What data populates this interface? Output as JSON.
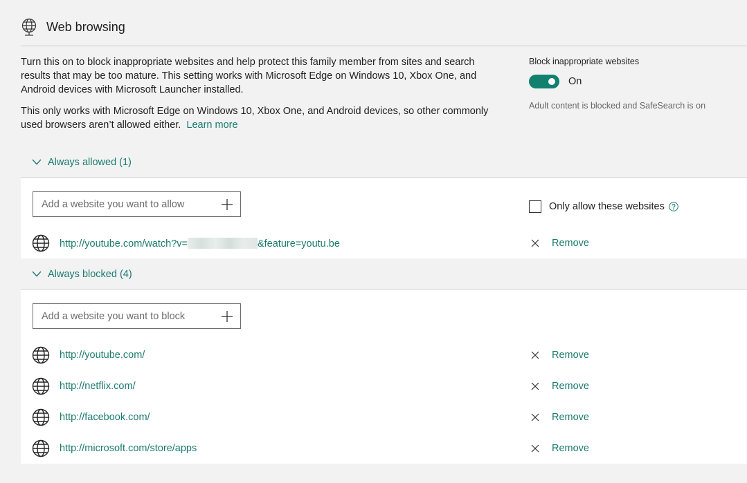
{
  "header": {
    "title": "Web browsing",
    "icon": "web-filter-icon"
  },
  "description": {
    "paragraph1": "Turn this on to block inappropriate websites and help protect this family member from sites and search results that may be too mature. This setting works with Microsoft Edge on Windows 10, Xbox One, and Android devices with Microsoft Launcher installed.",
    "paragraph2": "This only works with Microsoft Edge on Windows 10, Xbox One, and Android devices, so other commonly used browsers aren’t allowed either.",
    "learn_more": "Learn more"
  },
  "toggle": {
    "title": "Block inappropriate websites",
    "state": "On",
    "enabled": true,
    "subtitle": "Adult content is blocked and SafeSearch is on"
  },
  "allowed": {
    "header": "Always allowed (1)",
    "placeholder": "Add a website you want to allow",
    "only_allow_label": "Only allow these websites",
    "only_allow_checked": false,
    "items": [
      {
        "url_prefix": "http://youtube.com/watch?v=",
        "url_suffix": "&feature=youtu.be",
        "remove": "Remove"
      }
    ]
  },
  "blocked": {
    "header": "Always blocked (4)",
    "placeholder": "Add a website you want to block",
    "items": [
      {
        "url": "http://youtube.com/",
        "remove": "Remove"
      },
      {
        "url": "http://netflix.com/",
        "remove": "Remove"
      },
      {
        "url": "http://facebook.com/",
        "remove": "Remove"
      },
      {
        "url": "http://microsoft.com/store/apps",
        "remove": "Remove"
      }
    ]
  },
  "colors": {
    "accent": "#1a7a6e",
    "toggle": "#12806f",
    "background": "#f2f2f2",
    "panel": "#ffffff"
  }
}
